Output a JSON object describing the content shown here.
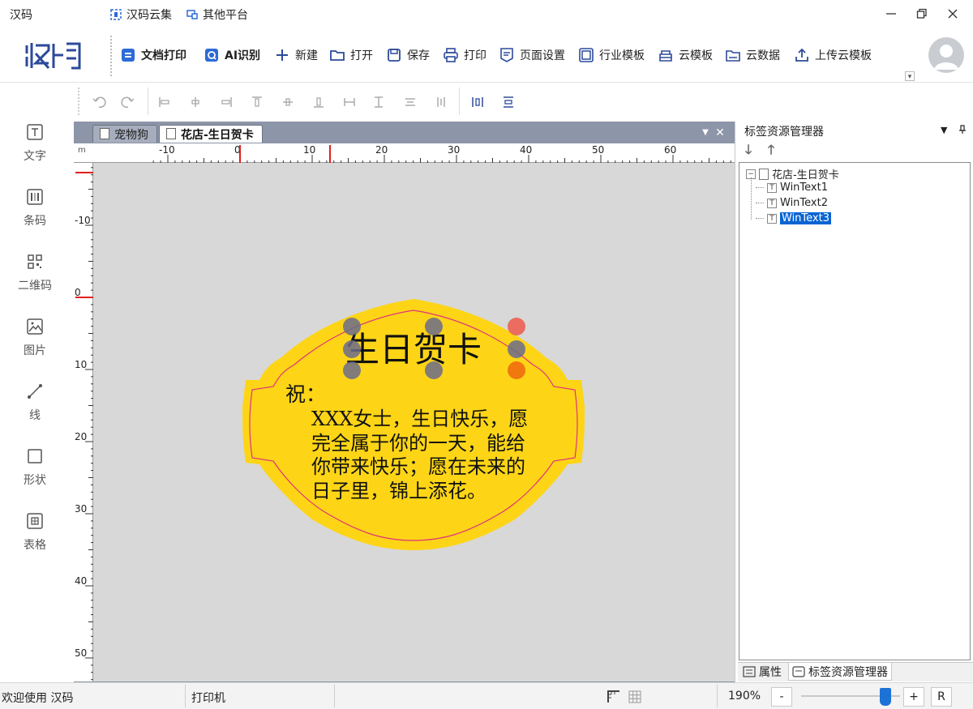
{
  "app": {
    "title": "汉码",
    "logo_text": "汉码"
  },
  "title_links": [
    {
      "label": "汉码云集",
      "icon": "cloud-collect-icon"
    },
    {
      "label": "其他平台",
      "icon": "platform-icon"
    }
  ],
  "toolbar": {
    "items": [
      {
        "label": "文档打印",
        "icon": "document-print-icon",
        "bold": true
      },
      {
        "label": "AI识别",
        "icon": "ai-scan-icon",
        "bold": true
      },
      {
        "label": "新建",
        "icon": "plus-icon"
      },
      {
        "label": "打开",
        "icon": "folder-icon"
      },
      {
        "label": "保存",
        "icon": "save-icon"
      },
      {
        "label": "打印",
        "icon": "printer-icon"
      },
      {
        "label": "页面设置",
        "icon": "page-setup-icon"
      },
      {
        "label": "行业模板",
        "icon": "template-icon"
      },
      {
        "label": "云模板",
        "icon": "cloud-template-icon"
      },
      {
        "label": "云数据",
        "icon": "cloud-data-icon"
      },
      {
        "label": "上传云模板",
        "icon": "upload-icon"
      }
    ]
  },
  "align_toolbar": {
    "icons": [
      "undo-icon",
      "redo-icon",
      "align-left-icon",
      "align-center-icon",
      "align-right-icon",
      "align-top-icon",
      "align-middle-icon",
      "align-bottom-icon",
      "same-width-icon",
      "same-height-icon",
      "h-distribute-icon",
      "v-distribute-icon",
      "center-horizontal-icon",
      "center-vertical-icon"
    ]
  },
  "left_tools": [
    {
      "label": "文字",
      "icon": "text-icon"
    },
    {
      "label": "条码",
      "icon": "barcode-icon"
    },
    {
      "label": "二维码",
      "icon": "qrcode-icon"
    },
    {
      "label": "图片",
      "icon": "image-icon"
    },
    {
      "label": "线",
      "icon": "line-icon"
    },
    {
      "label": "形状",
      "icon": "shape-icon"
    },
    {
      "label": "表格",
      "icon": "table-icon"
    }
  ],
  "doc_tabs": [
    {
      "label": "宠物狗",
      "active": false
    },
    {
      "label": "花店-生日贺卡",
      "active": true
    }
  ],
  "ruler": {
    "unit": "m",
    "h_labels": [
      "-10",
      "0",
      "10",
      "20",
      "30",
      "40",
      "50",
      "60"
    ],
    "v_labels": [
      "-10",
      "0",
      "10",
      "20",
      "30",
      "40",
      "50"
    ]
  },
  "label": {
    "title": "生日贺卡",
    "greeting": "祝：",
    "body_lines": [
      "XXX女士，生日快乐，愿",
      "完全属于你的一天，能给",
      "你带来快乐；愿在未来的",
      "日子里，锦上添花。"
    ],
    "fill_color": "#fdd516",
    "border_color": "#e0327a"
  },
  "right_panel": {
    "title": "标签资源管理器",
    "tree": {
      "root": "花店-生日贺卡",
      "children": [
        {
          "label": "WinText1",
          "selected": false
        },
        {
          "label": "WinText2",
          "selected": false
        },
        {
          "label": "WinText3",
          "selected": true
        }
      ]
    },
    "tabs": [
      {
        "label": "属性",
        "active": false
      },
      {
        "label": "标签资源管理器",
        "active": true
      }
    ]
  },
  "status": {
    "welcome": "欢迎使用 汉码",
    "printer": "打印机",
    "zoom": "190%",
    "zoom_minus": "-",
    "zoom_plus": "+",
    "zoom_reset": "R",
    "zoom_level": 0.85
  },
  "colors": {
    "accent": "#1d72d6",
    "logo": "#2c4a9a",
    "selection": "#0a64d2"
  }
}
